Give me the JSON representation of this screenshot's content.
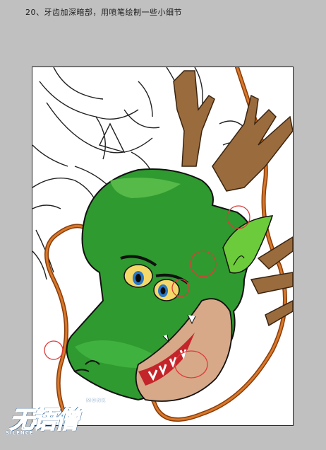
{
  "caption": "20、牙齿加深暗部，用喷笔绘制一些小细节",
  "watermark": {
    "main": "无语僧",
    "sub_left": "SILENCE",
    "sub_right": "MONK"
  },
  "colors": {
    "workspace": "#c0c0c0",
    "dragon_green": "#2f9a2f",
    "dragon_dark": "#1f6b1f",
    "horn_brown": "#9a6b3c",
    "whisker_orange": "#c8641e",
    "highlight_circle": "#e03a3a"
  }
}
